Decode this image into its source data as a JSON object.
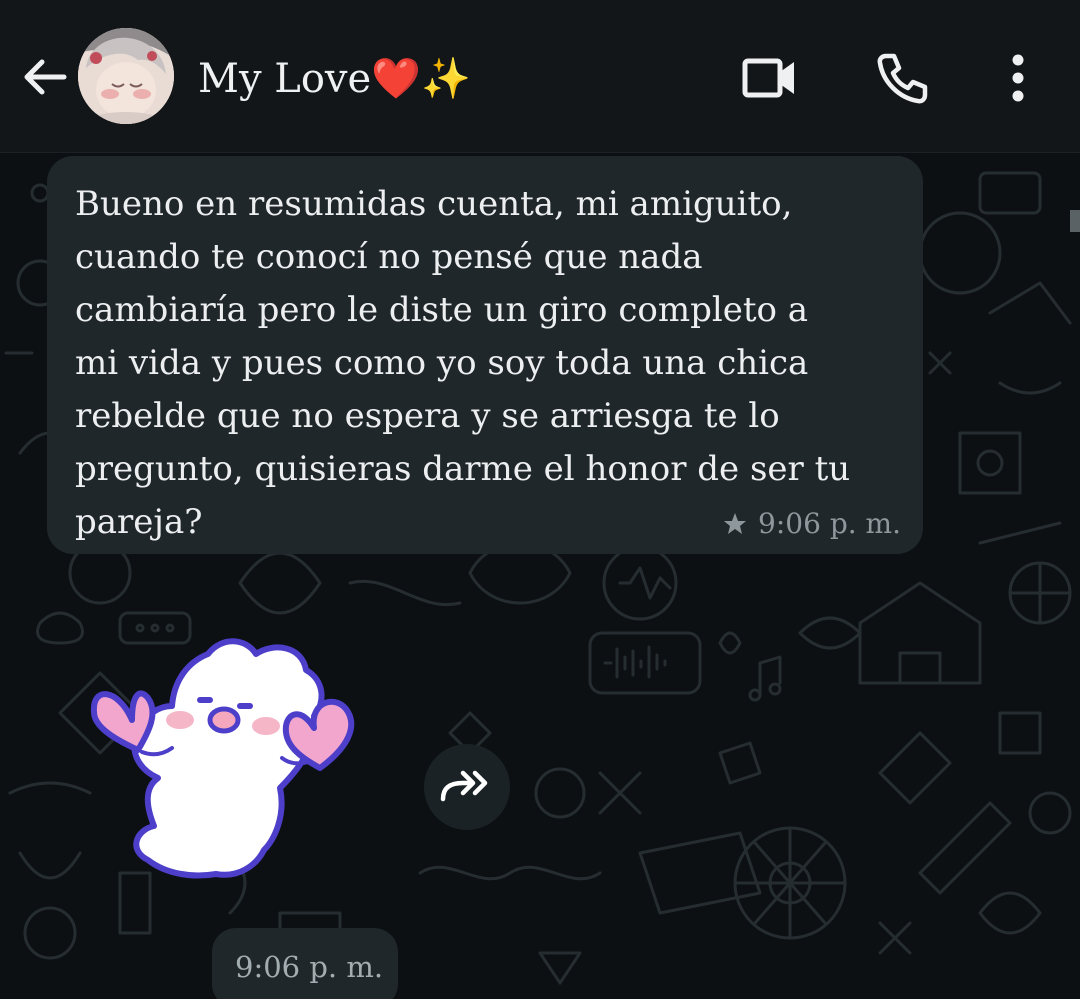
{
  "header": {
    "back_icon": "arrow-left-icon",
    "contact_name": "My Love❤️✨",
    "video_icon": "video-call-icon",
    "call_icon": "phone-icon",
    "menu_icon": "more-vertical-icon"
  },
  "messages": [
    {
      "direction": "incoming",
      "text": "Bueno en resumidas cuenta, mi amiguito,\ncuando te conocí no pensé que nada\ncambiaría pero le diste un giro completo a\nmi vida y pues como yo soy toda una chica\nrebelde que no espera y se arriesga te lo\npregunto, quisieras darme el honor de ser tu\npareja?",
      "starred": true,
      "time": "9:06 p. m."
    },
    {
      "direction": "incoming",
      "type": "sticker",
      "sticker_icon": "ghost-hearts-sticker",
      "forward_icon": "forward-icon",
      "time": "9:06 p. m."
    }
  ],
  "colors": {
    "header_bg": "#121619",
    "chat_bg": "#0c1013",
    "bubble_bg": "#1f272b",
    "text": "#eceeef",
    "meta": "#8e979c",
    "doodle": "#262d31"
  }
}
